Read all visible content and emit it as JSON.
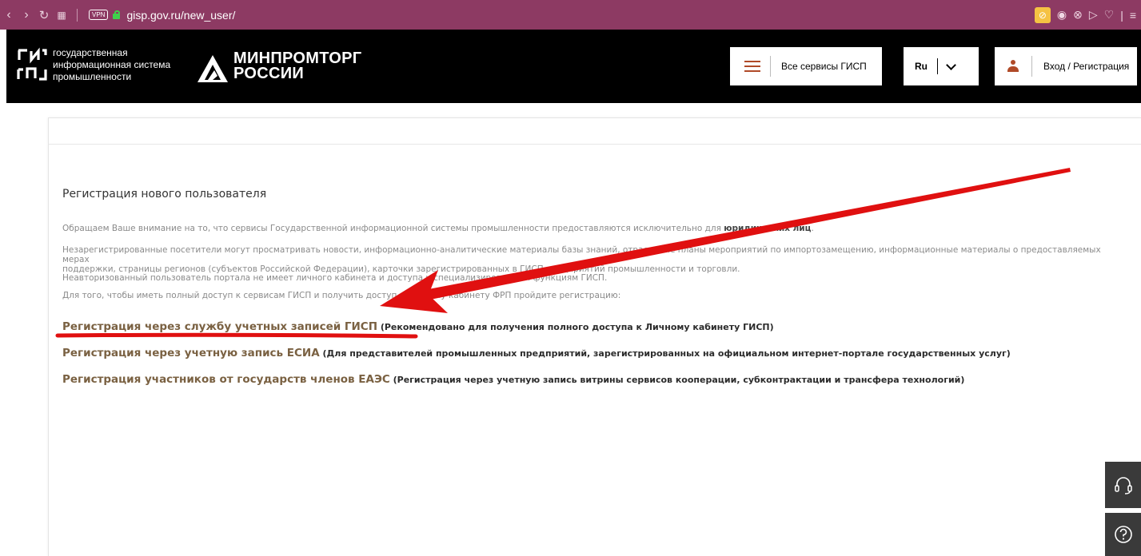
{
  "browser": {
    "vpn_label": "VPN",
    "url": "gisp.gov.ru/new_user/"
  },
  "header": {
    "gisp_logo_lines": [
      "государственная",
      "информационная система",
      "промышленности"
    ],
    "minprom_lines": [
      "МИНПРОМТОРГ",
      "РОССИИ"
    ],
    "services_label": "Все сервисы ГИСП",
    "lang_label": "Ru",
    "login_label": "Вход / Регистрация"
  },
  "content": {
    "title": "Регистрация нового пользователя",
    "p1_text": "Обращаем Ваше внимание на то, что сервисы Государственной информационной системы промышленности предоставляются исключительно для ",
    "p1_bold": "юридических лиц",
    "p1_end": ".",
    "p2_line1": "Незарегистрированные посетители могут просматривать новости, информационно-аналитические материалы базы знаний, отраслевые планы мероприятий по импортозамещению, информационные материалы о предоставляемых мерах",
    "p2_line2": "поддержки, страницы регионов (субъектов Российской Федерации), карточки зарегистрированных в ГИСП предприятий промышленности и торговли.",
    "p3": "Неавторизованный пользователь портала не имеет личного кабинета и доступа к специализированным функциям ГИСП.",
    "p4": "Для того, чтобы иметь полный доступ к сервисам ГИСП и получить доступ к Личному кабинету ФРП пройдите регистрацию:",
    "links": [
      {
        "main": "Регистрация через службу учетных записей ГИСП",
        "note": " (Рекомендовано для получения полного доступа к Личному кабинету ГИСП)"
      },
      {
        "main": "Регистрация через учетную запись ЕСИА",
        "note": " (Для представителей промышленных предприятий, зарегистрированных на официальном интернет-портале государственных услуг)"
      },
      {
        "main": "Регистрация участников от государств членов ЕАЭС",
        "note": " (Регистрация через учетную запись витрины сервисов кооперации, субконтрактации и трансфера технологий)"
      }
    ]
  },
  "colors": {
    "browser_bar": "#8d3a63",
    "header_bg": "#000000",
    "accent": "#b04a28",
    "link_brown": "#7a6142",
    "annotation_red": "#e01010"
  },
  "icons": [
    "back-icon",
    "forward-icon",
    "reload-icon",
    "tabs-grid-icon",
    "lock-icon",
    "camera-icon",
    "close-circle-icon",
    "send-icon",
    "heart-icon",
    "menu-icon",
    "burger-icon",
    "chevron-down-icon",
    "user-icon",
    "headset-icon",
    "help-icon"
  ]
}
